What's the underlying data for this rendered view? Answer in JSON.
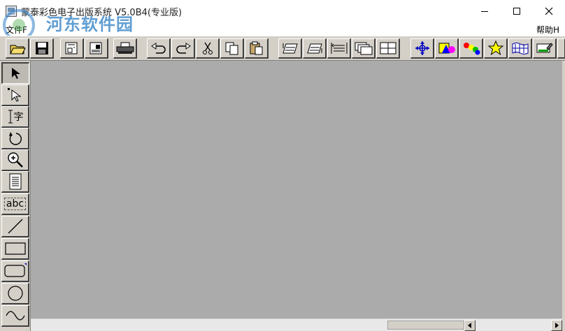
{
  "window": {
    "title": "蒙泰彩色电子出版系统 V5.0B4(专业版)"
  },
  "watermark": {
    "title": "河东软件园",
    "url": "www.pc0359.cn"
  },
  "menu": {
    "items": [
      "文件F",
      "帮助H"
    ]
  },
  "toolbar": {
    "icons": [
      "open-folder-icon",
      "save-icon",
      "preview-icon",
      "print-setup-icon",
      "print-icon",
      "undo-icon",
      "redo-icon",
      "cut-icon",
      "copy-icon",
      "paste-icon",
      "bring-forward-icon",
      "send-backward-icon",
      "align-icon",
      "group-icon",
      "ungroup-icon",
      "move-crosshair-icon",
      "shapes-color-icon",
      "palette-icon",
      "star-icon",
      "texture-icon",
      "image-edit-icon"
    ]
  },
  "toolbox": {
    "items": [
      {
        "name": "select-tool",
        "icon": "arrow-icon"
      },
      {
        "name": "node-select-tool",
        "icon": "node-arrow-icon"
      },
      {
        "name": "text-tool",
        "icon": "text-cursor-icon",
        "label": "字"
      },
      {
        "name": "rotate-tool",
        "icon": "rotate-icon"
      },
      {
        "name": "zoom-tool",
        "icon": "zoom-icon"
      },
      {
        "name": "page-tool",
        "icon": "page-icon"
      },
      {
        "name": "textbox-tool",
        "icon": "textbox-icon",
        "label": "abc"
      },
      {
        "name": "line-tool",
        "icon": "line-icon"
      },
      {
        "name": "rectangle-tool",
        "icon": "rectangle-icon"
      },
      {
        "name": "rounded-rect-tool",
        "icon": "rounded-rect-icon"
      },
      {
        "name": "ellipse-tool",
        "icon": "ellipse-icon"
      },
      {
        "name": "curve-tool",
        "icon": "curve-icon"
      }
    ]
  },
  "colors": {
    "canvas": "#ababab",
    "panel": "#d4d0c8",
    "watermark_blue": "#3a86c8",
    "watermark_green": "#3aa64e"
  }
}
